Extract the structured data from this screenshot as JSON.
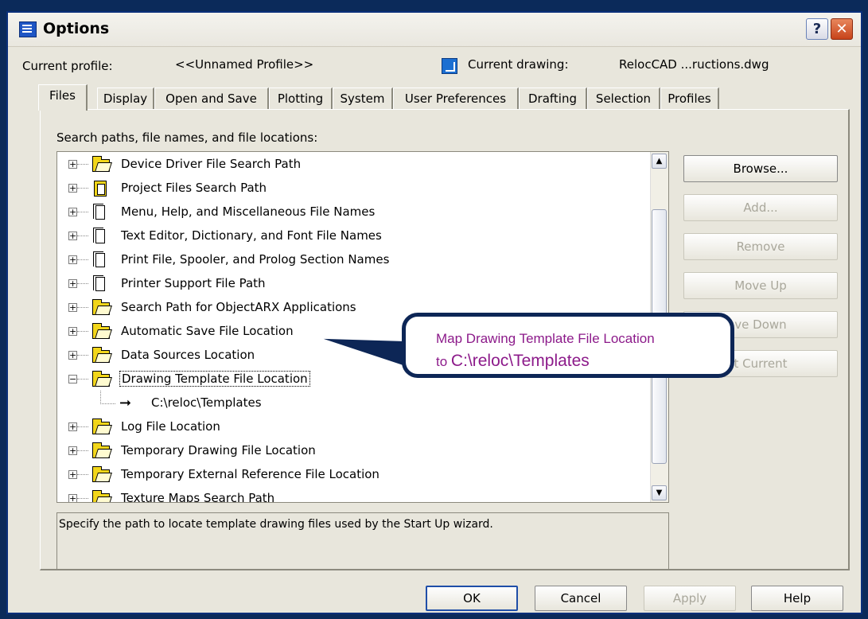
{
  "window": {
    "title": "Options"
  },
  "profile": {
    "current_profile_label": "Current profile:",
    "current_profile_value": "<<Unnamed Profile>>",
    "current_drawing_label": "Current drawing:",
    "current_drawing_value": "RelocCAD ...ructions.dwg"
  },
  "tabs": [
    "Files",
    "Display",
    "Open and Save",
    "Plotting",
    "System",
    "User Preferences",
    "Drafting",
    "Selection",
    "Profiles"
  ],
  "active_tab": "Files",
  "files": {
    "section_label": "Search paths, file names, and file locations:",
    "tree": [
      {
        "label": "Device Driver File Search Path",
        "icon": "folder-icon",
        "expanded": false
      },
      {
        "label": "Project Files Search Path",
        "icon": "project-icon",
        "expanded": false
      },
      {
        "label": "Menu, Help, and Miscellaneous File Names",
        "icon": "document-icon",
        "expanded": false
      },
      {
        "label": "Text Editor, Dictionary, and Font File Names",
        "icon": "document-icon",
        "expanded": false
      },
      {
        "label": "Print File, Spooler, and Prolog Section Names",
        "icon": "document-icon",
        "expanded": false
      },
      {
        "label": "Printer Support File Path",
        "icon": "document-icon",
        "expanded": false
      },
      {
        "label": "Search Path for ObjectARX Applications",
        "icon": "folder-icon",
        "expanded": false
      },
      {
        "label": "Automatic Save File Location",
        "icon": "folder-icon",
        "expanded": false
      },
      {
        "label": "Data Sources Location",
        "icon": "folder-icon",
        "expanded": false
      },
      {
        "label": "Drawing Template File Location",
        "icon": "folder-icon",
        "expanded": true,
        "selected": true
      },
      {
        "label": "C:\\reloc\\Templates",
        "icon": "arrow-icon",
        "child": true
      },
      {
        "label": "Log File Location",
        "icon": "folder-icon",
        "expanded": false
      },
      {
        "label": "Temporary Drawing File Location",
        "icon": "folder-icon",
        "expanded": false
      },
      {
        "label": "Temporary External Reference File Location",
        "icon": "folder-icon",
        "expanded": false
      },
      {
        "label": "Texture Maps Search Path",
        "icon": "folder-icon",
        "expanded": false
      }
    ],
    "description": "Specify the path to locate template drawing files used by the Start Up wizard."
  },
  "side_buttons": [
    {
      "label": "Browse...",
      "enabled": true
    },
    {
      "label": "Add...",
      "enabled": false
    },
    {
      "label": "Remove",
      "enabled": false
    },
    {
      "label": "Move Up",
      "enabled": false
    },
    {
      "label": "ve Down",
      "enabled": false
    },
    {
      "label": "t Current",
      "enabled": false
    }
  ],
  "callout": {
    "line1": "Map Drawing Template File Location",
    "line2_prefix": "to ",
    "line2_path": "C:\\reloc\\Templates"
  },
  "dialog_buttons": {
    "ok": "OK",
    "cancel": "Cancel",
    "apply": "Apply",
    "help": "Help"
  },
  "colors": {
    "title_bar": "#0a2f7a",
    "callout_text": "#8c1a8a",
    "callout_border": "#0d2656"
  }
}
